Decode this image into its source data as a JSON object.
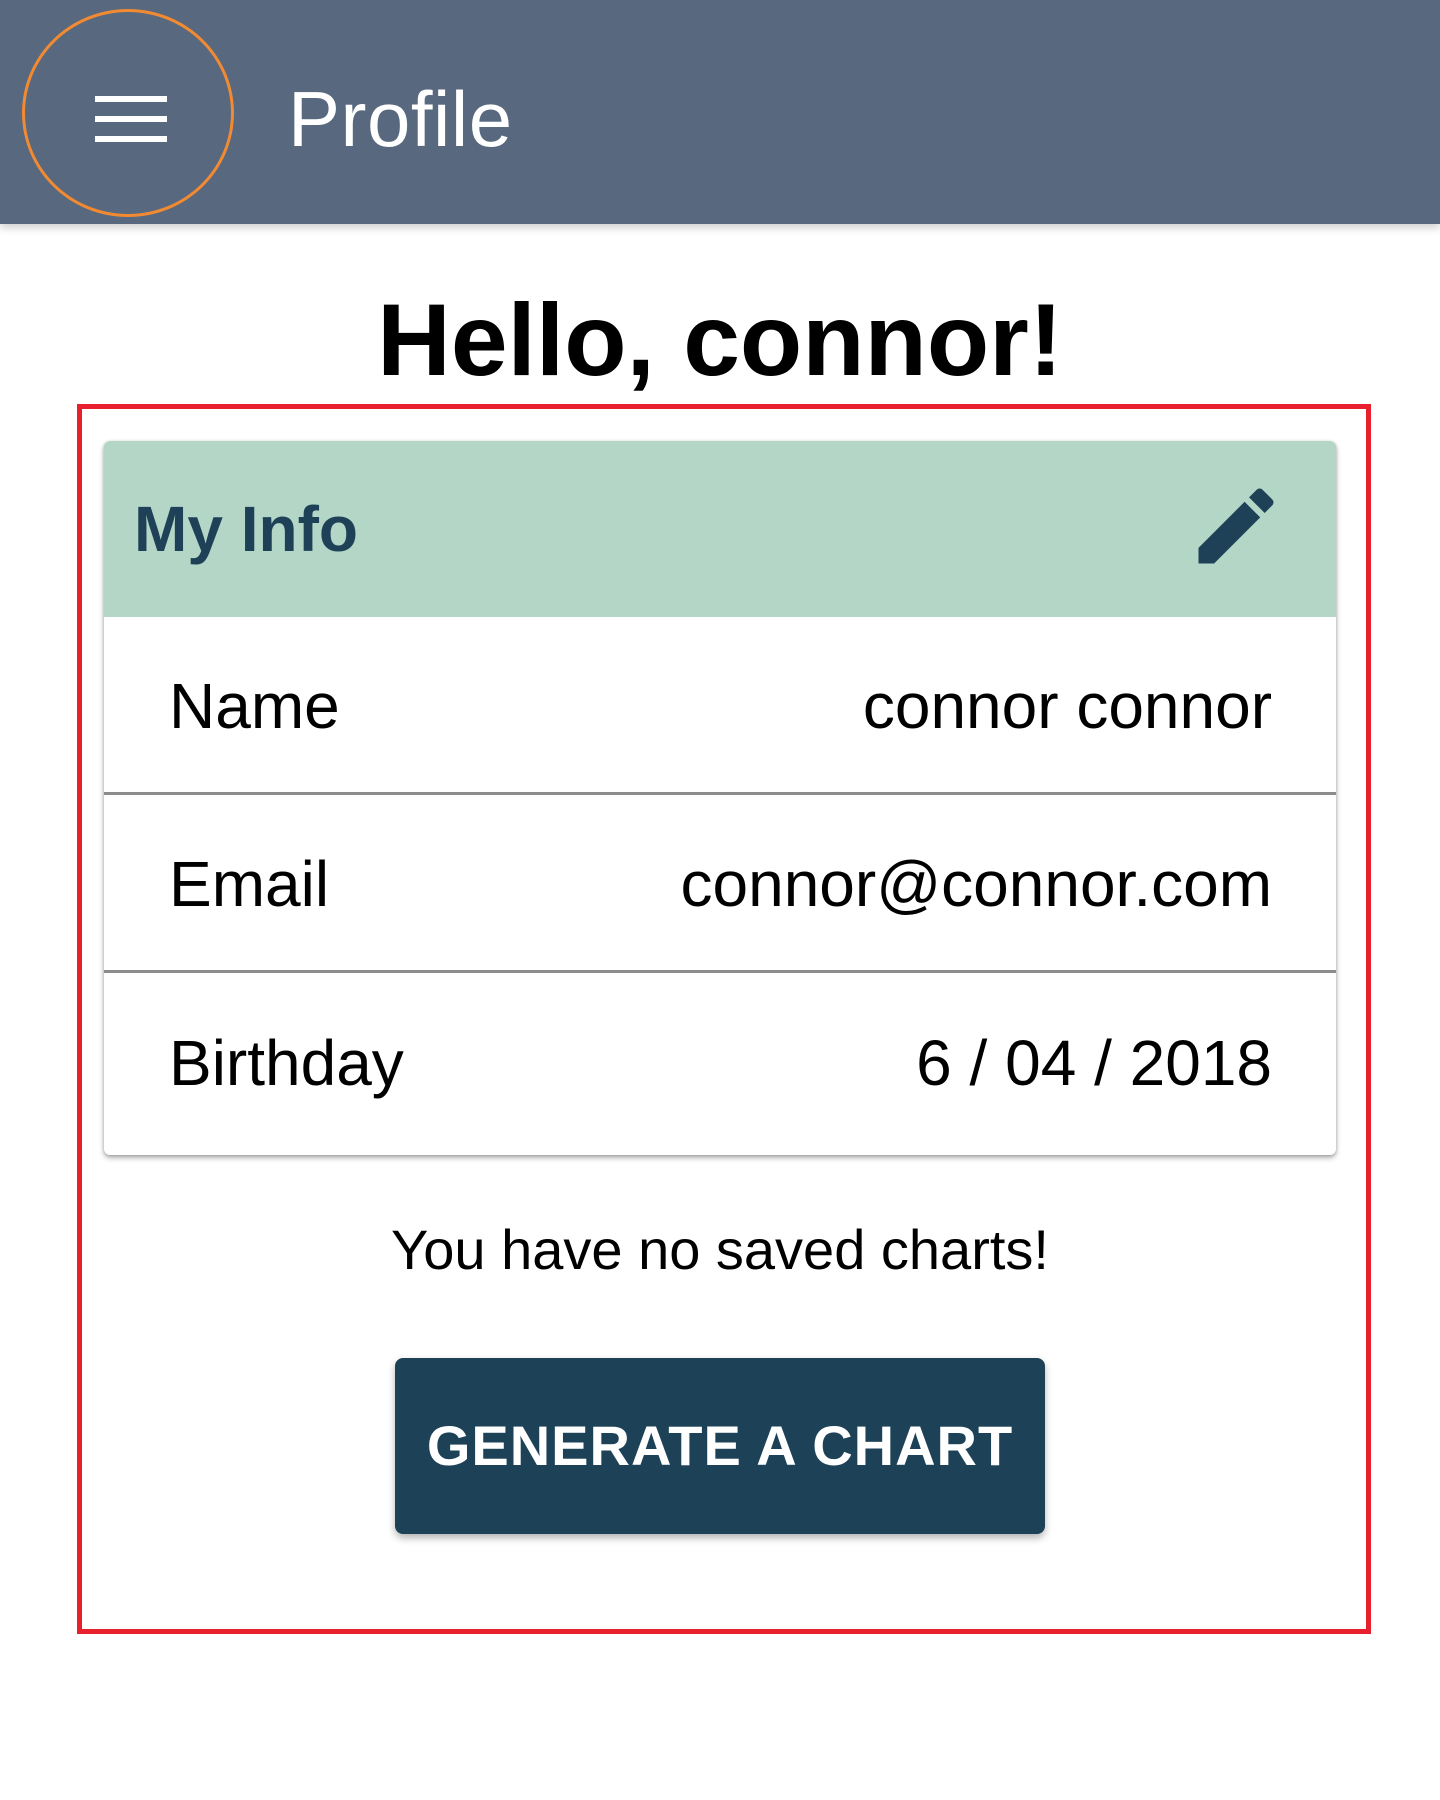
{
  "app_bar": {
    "title": "Profile",
    "menu_icon": "hamburger-menu-icon",
    "background_color": "#58687f",
    "menu_highlight_color": "#f28a32"
  },
  "greeting": "Hello, connor!",
  "info_card": {
    "title": "My Info",
    "edit_icon": "pencil-icon",
    "header_color": "#b3d6c6",
    "rows": [
      {
        "label": "Name",
        "value": "connor connor"
      },
      {
        "label": "Email",
        "value": "connor@connor.com"
      },
      {
        "label": "Birthday",
        "value": "6 / 04 / 2018"
      }
    ]
  },
  "charts": {
    "empty_message": "You have no saved charts!",
    "generate_button_label": "GENERATE A CHART",
    "button_color": "#1d4257"
  },
  "highlight_color": "#e81f2c"
}
